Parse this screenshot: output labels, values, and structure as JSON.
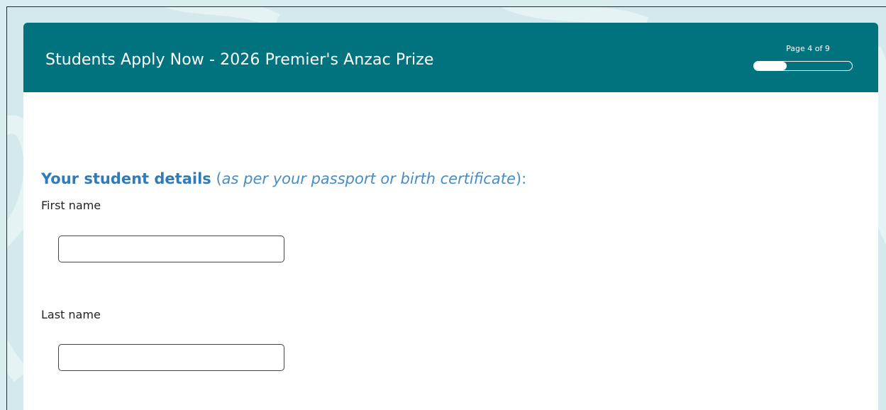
{
  "form": {
    "title": "Students Apply Now - 2026 Premier's Anzac Prize",
    "page_indicator": "Page 4 of 9",
    "current_page": 4,
    "total_pages": 9,
    "progress_fraction": 0.33
  },
  "section": {
    "heading_strong": "Your student details",
    "heading_open": " (",
    "heading_italic": "as per your passport or birth certificate",
    "heading_close": "):"
  },
  "fields": {
    "first_name": {
      "label": "First name",
      "value": ""
    },
    "last_name": {
      "label": "Last name",
      "value": ""
    }
  },
  "colors": {
    "header": "#00737f",
    "heading": "#2f7ab8",
    "background": "#d9ecee"
  }
}
